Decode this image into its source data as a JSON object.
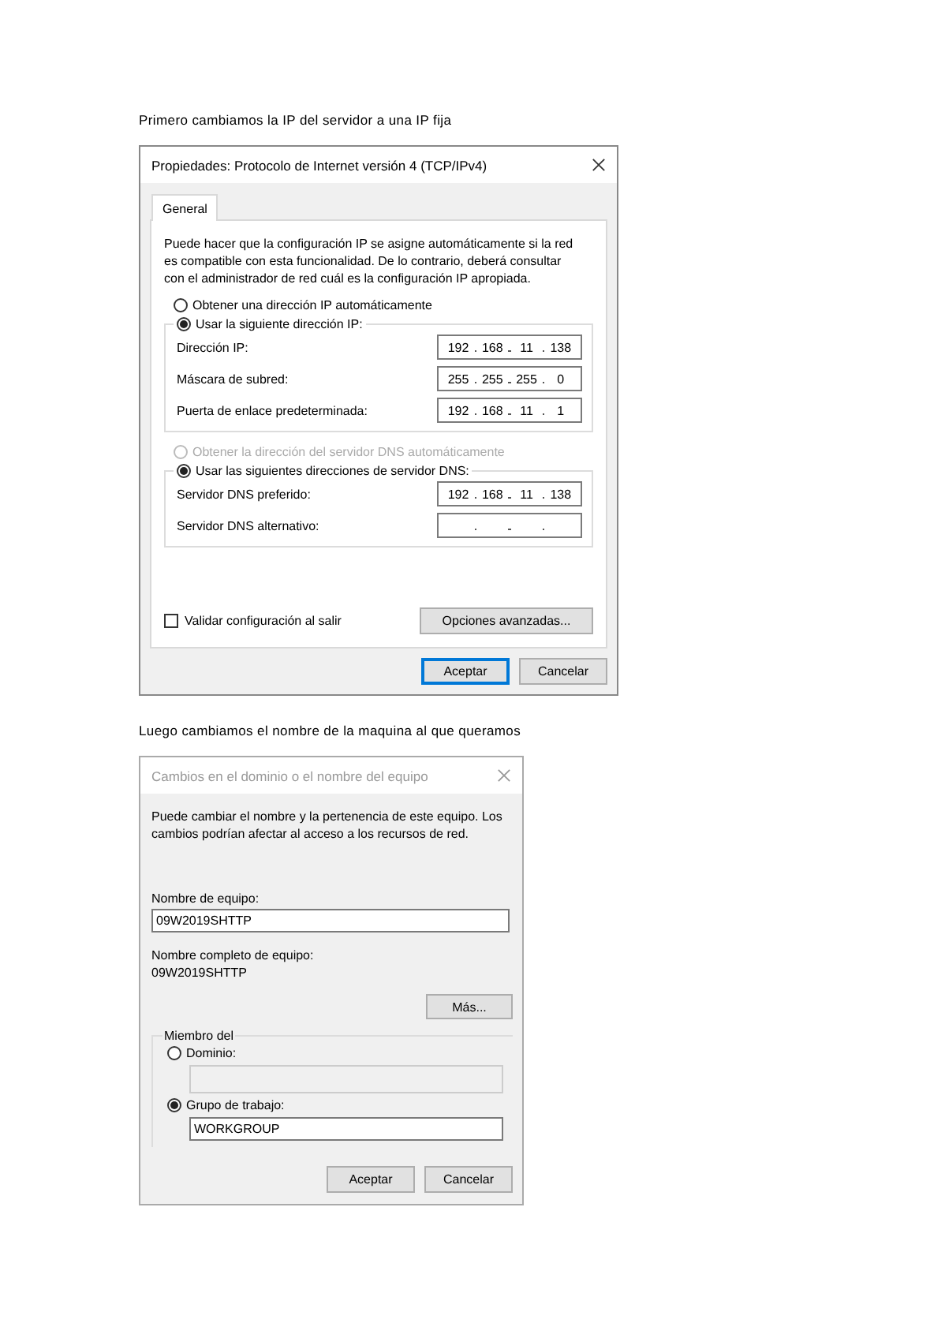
{
  "heading_1": "Primero cambiamos la IP del servidor a una IP fija",
  "ip_dialog": {
    "title": "Propiedades: Protocolo de Internet versión 4 (TCP/IPv4)",
    "tabs": [
      {
        "label": "General",
        "selected": true
      }
    ],
    "description": "Puede hacer que la configuración IP se asigne automáticamente si la red es compatible con esta funcionalidad. De lo contrario, deberá consultar con el administrador de red cuál es la configuración IP apropiada.",
    "ip_options": [
      {
        "label": "Obtener una dirección IP automáticamente",
        "selected": false,
        "disabled": false
      },
      {
        "label": "Usar la siguiente dirección IP:",
        "selected": true,
        "disabled": false
      }
    ],
    "ip_fields": [
      {
        "label": "Dirección IP:",
        "octets": [
          "192",
          "168",
          "11",
          "138"
        ]
      },
      {
        "label": "Máscara de subred:",
        "octets": [
          "255",
          "255",
          "255",
          "0"
        ]
      },
      {
        "label": "Puerta de enlace predeterminada:",
        "octets": [
          "192",
          "168",
          "11",
          "1"
        ]
      }
    ],
    "dns_options": [
      {
        "label": "Obtener la dirección del servidor DNS automáticamente",
        "selected": false,
        "disabled": true
      },
      {
        "label": "Usar las siguientes direcciones de servidor DNS:",
        "selected": true,
        "disabled": false
      }
    ],
    "dns_fields": [
      {
        "label": "Servidor DNS preferido:",
        "octets": [
          "192",
          "168",
          "11",
          "138"
        ]
      },
      {
        "label": "Servidor DNS alternativo:"
      }
    ],
    "validate": {
      "label": "Validar configuración al salir",
      "checked": false
    },
    "advanced_button": "Opciones avanzadas...",
    "buttons": [
      {
        "label": "Aceptar",
        "default": true
      },
      {
        "label": "Cancelar",
        "default": false
      }
    ]
  },
  "heading_2": "Luego cambiamos el nombre de la maquina al que queramos",
  "name_dialog": {
    "title": "Cambios en el dominio o el nombre del equipo",
    "active": false,
    "description": "Puede cambiar el nombre y la pertenencia de este equipo. Los cambios podrían afectar al acceso a los recursos de red.",
    "computer_name_label": "Nombre de equipo:",
    "computer_name_value": "09W2019SHTTP",
    "full_name_label": "Nombre completo de equipo:",
    "full_name_value": "09W2019SHTTP",
    "more_button": "Más...",
    "member_group": "Miembro del",
    "member_options": [
      {
        "label": "Dominio:",
        "selected": false
      },
      {
        "label": "Grupo de trabajo:",
        "selected": true,
        "value": "WORKGROUP"
      }
    ],
    "buttons": [
      {
        "label": "Aceptar",
        "default": false
      },
      {
        "label": "Cancelar",
        "default": false
      }
    ]
  }
}
